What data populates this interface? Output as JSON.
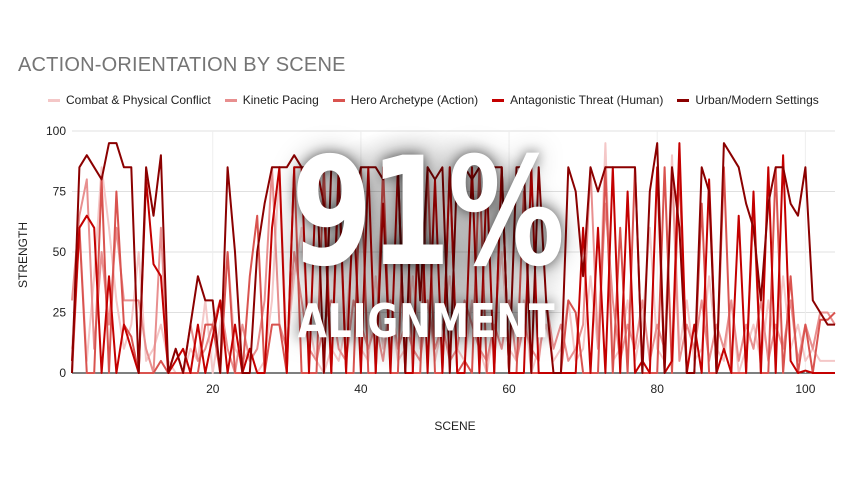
{
  "chart_data": {
    "type": "line",
    "title": "ACTION-ORIENTATION BY SCENE",
    "xlabel": "SCENE",
    "ylabel": "STRENGTH",
    "xlim": [
      1,
      104
    ],
    "ylim": [
      0,
      100
    ],
    "xticks": [
      20,
      40,
      60,
      80,
      100
    ],
    "yticks": [
      0,
      25,
      50,
      75,
      100
    ],
    "grid": "horizontal",
    "legend_position": "top",
    "series": [
      {
        "name": "Combat & Physical Conflict",
        "color": "#f4c7c7",
        "values": [
          10,
          60,
          5,
          40,
          85,
          60,
          30,
          10,
          20,
          50,
          5,
          10,
          20,
          5,
          0,
          0,
          10,
          5,
          30,
          0,
          20,
          50,
          10,
          5,
          10,
          0,
          5,
          30,
          85,
          10,
          40,
          60,
          20,
          5,
          0,
          10,
          5,
          20,
          60,
          10,
          5,
          40,
          10,
          30,
          5,
          10,
          40,
          10,
          30,
          5,
          20,
          40,
          10,
          5,
          30,
          10,
          0,
          20,
          50,
          10,
          5,
          30,
          0,
          10,
          20,
          5,
          10,
          30,
          5,
          10,
          40,
          10,
          95,
          5,
          10,
          30,
          5,
          20,
          60,
          10,
          5,
          90,
          10,
          30,
          5,
          10,
          40,
          10,
          5,
          30,
          0,
          10,
          20,
          5,
          30,
          10,
          40,
          10,
          20,
          5,
          10,
          5,
          5,
          5
        ]
      },
      {
        "name": "Kinetic Pacing",
        "color": "#e88f8f",
        "values": [
          30,
          65,
          80,
          10,
          50,
          20,
          60,
          30,
          30,
          30,
          10,
          0,
          60,
          0,
          10,
          0,
          20,
          5,
          10,
          20,
          30,
          10,
          0,
          20,
          5,
          10,
          30,
          85,
          20,
          10,
          50,
          30,
          10,
          5,
          20,
          30,
          10,
          5,
          30,
          20,
          10,
          20,
          5,
          30,
          10,
          20,
          10,
          5,
          30,
          10,
          20,
          5,
          10,
          30,
          20,
          10,
          5,
          20,
          10,
          30,
          5,
          20,
          10,
          5,
          30,
          10,
          20,
          5,
          10,
          20,
          85,
          10,
          70,
          30,
          5,
          20,
          10,
          30,
          5,
          20,
          10,
          85,
          5,
          20,
          10,
          30,
          5,
          20,
          10,
          30,
          5,
          20,
          10,
          30,
          5,
          20,
          10,
          30,
          5,
          20,
          10,
          25,
          25,
          20
        ]
      },
      {
        "name": "Hero Archetype (Action)",
        "color": "#d9534f",
        "values": [
          0,
          60,
          0,
          0,
          80,
          0,
          75,
          20,
          15,
          0,
          0,
          0,
          5,
          0,
          0,
          0,
          0,
          0,
          20,
          20,
          0,
          50,
          0,
          0,
          40,
          65,
          0,
          20,
          20,
          0,
          85,
          0,
          0,
          0,
          85,
          0,
          80,
          0,
          0,
          85,
          0,
          0,
          85,
          0,
          0,
          85,
          0,
          0,
          85,
          0,
          0,
          85,
          0,
          5,
          0,
          85,
          0,
          0,
          85,
          0,
          0,
          75,
          0,
          0,
          0,
          0,
          0,
          30,
          25,
          0,
          0,
          0,
          85,
          0,
          60,
          0,
          85,
          0,
          0,
          0,
          85,
          0,
          85,
          0,
          0,
          70,
          0,
          0,
          85,
          0,
          0,
          0,
          70,
          0,
          0,
          85,
          0,
          40,
          0,
          20,
          0,
          22,
          22,
          25
        ]
      },
      {
        "name": "Antagonistic Threat (Human)",
        "color": "#c40000",
        "values": [
          5,
          60,
          65,
          60,
          0,
          40,
          0,
          20,
          10,
          0,
          80,
          45,
          40,
          0,
          5,
          10,
          0,
          20,
          0,
          15,
          30,
          0,
          20,
          0,
          10,
          0,
          0,
          60,
          85,
          0,
          85,
          85,
          0,
          85,
          70,
          0,
          85,
          0,
          70,
          0,
          85,
          0,
          70,
          0,
          85,
          0,
          0,
          85,
          0,
          80,
          0,
          85,
          0,
          0,
          85,
          0,
          80,
          0,
          85,
          0,
          0,
          0,
          85,
          0,
          0,
          0,
          0,
          0,
          0,
          60,
          0,
          60,
          0,
          85,
          0,
          75,
          0,
          5,
          0,
          85,
          0,
          5,
          95,
          0,
          20,
          0,
          80,
          0,
          10,
          0,
          65,
          0,
          75,
          0,
          85,
          0,
          90,
          5,
          0,
          1,
          0,
          0,
          0,
          0
        ]
      },
      {
        "name": "Urban/Modern Settings",
        "color": "#8b0000",
        "values": [
          0,
          85,
          90,
          85,
          80,
          95,
          95,
          85,
          85,
          0,
          85,
          65,
          90,
          0,
          10,
          0,
          20,
          40,
          30,
          30,
          0,
          85,
          50,
          0,
          0,
          50,
          70,
          85,
          85,
          85,
          90,
          85,
          85,
          85,
          0,
          85,
          85,
          80,
          70,
          85,
          85,
          85,
          80,
          85,
          85,
          0,
          85,
          30,
          85,
          80,
          85,
          0,
          85,
          85,
          80,
          85,
          85,
          85,
          85,
          0,
          85,
          85,
          0,
          85,
          30,
          0,
          0,
          85,
          75,
          40,
          85,
          75,
          85,
          85,
          85,
          85,
          85,
          0,
          75,
          95,
          0,
          85,
          60,
          0,
          0,
          85,
          75,
          0,
          95,
          90,
          85,
          70,
          60,
          30,
          70,
          85,
          85,
          70,
          65,
          85,
          30,
          25,
          20,
          20
        ]
      }
    ]
  },
  "overlay": {
    "percent": "91%",
    "label": "ALIGNMENT"
  }
}
